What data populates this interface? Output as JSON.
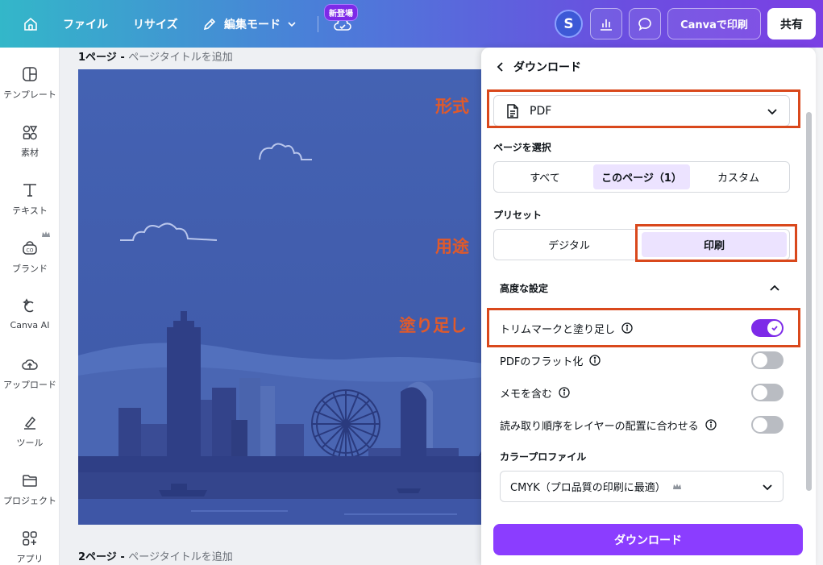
{
  "topbar": {
    "file": "ファイル",
    "resize": "リサイズ",
    "edit_mode": "編集モード",
    "new_badge": "新登場",
    "avatar_initial": "S",
    "print_button": "Canvaで印刷",
    "share_button": "共有"
  },
  "sidebar": {
    "items": [
      {
        "label": "テンプレート",
        "icon": "template-icon"
      },
      {
        "label": "素材",
        "icon": "elements-icon"
      },
      {
        "label": "テキスト",
        "icon": "text-icon"
      },
      {
        "label": "ブランド",
        "icon": "brand-icon"
      },
      {
        "label": "Canva AI",
        "icon": "ai-icon"
      },
      {
        "label": "アップロード",
        "icon": "upload-icon"
      },
      {
        "label": "ツール",
        "icon": "tools-icon"
      },
      {
        "label": "プロジェクト",
        "icon": "folder-icon"
      },
      {
        "label": "アプリ",
        "icon": "apps-icon"
      }
    ]
  },
  "canvas": {
    "page1_number": "1ページ",
    "page1_title": "ページタイトルを追加",
    "page2_number": "2ページ",
    "page2_title": "ページタイトルを追加",
    "separator": "-"
  },
  "panel": {
    "title": "ダウンロード",
    "format_value": "PDF",
    "page_select_label": "ページを選択",
    "page_options": [
      "すべて",
      "このページ（1）",
      "カスタム"
    ],
    "page_selected": "このページ（1）",
    "preset_label": "プリセット",
    "preset_options": [
      "デジタル",
      "印刷"
    ],
    "preset_selected": "印刷",
    "advanced_label": "高度な設定",
    "advanced_options": [
      {
        "label": "トリムマークと塗り足し",
        "on": true
      },
      {
        "label": "PDFのフラット化",
        "on": false
      },
      {
        "label": "メモを含む",
        "on": false
      },
      {
        "label": "読み取り順序をレイヤーの配置に合わせる",
        "on": false
      }
    ],
    "color_profile_label": "カラープロファイル",
    "color_profile_value": "CMYK（プロ品質の印刷に最適）",
    "download_button": "ダウンロード"
  },
  "annotations": {
    "format": "形式",
    "purpose": "用途",
    "bleed": "塗り足し",
    "color": "#d9481c"
  },
  "colors": {
    "accent": "#8b3dff",
    "design_bg": "#4058a8"
  }
}
